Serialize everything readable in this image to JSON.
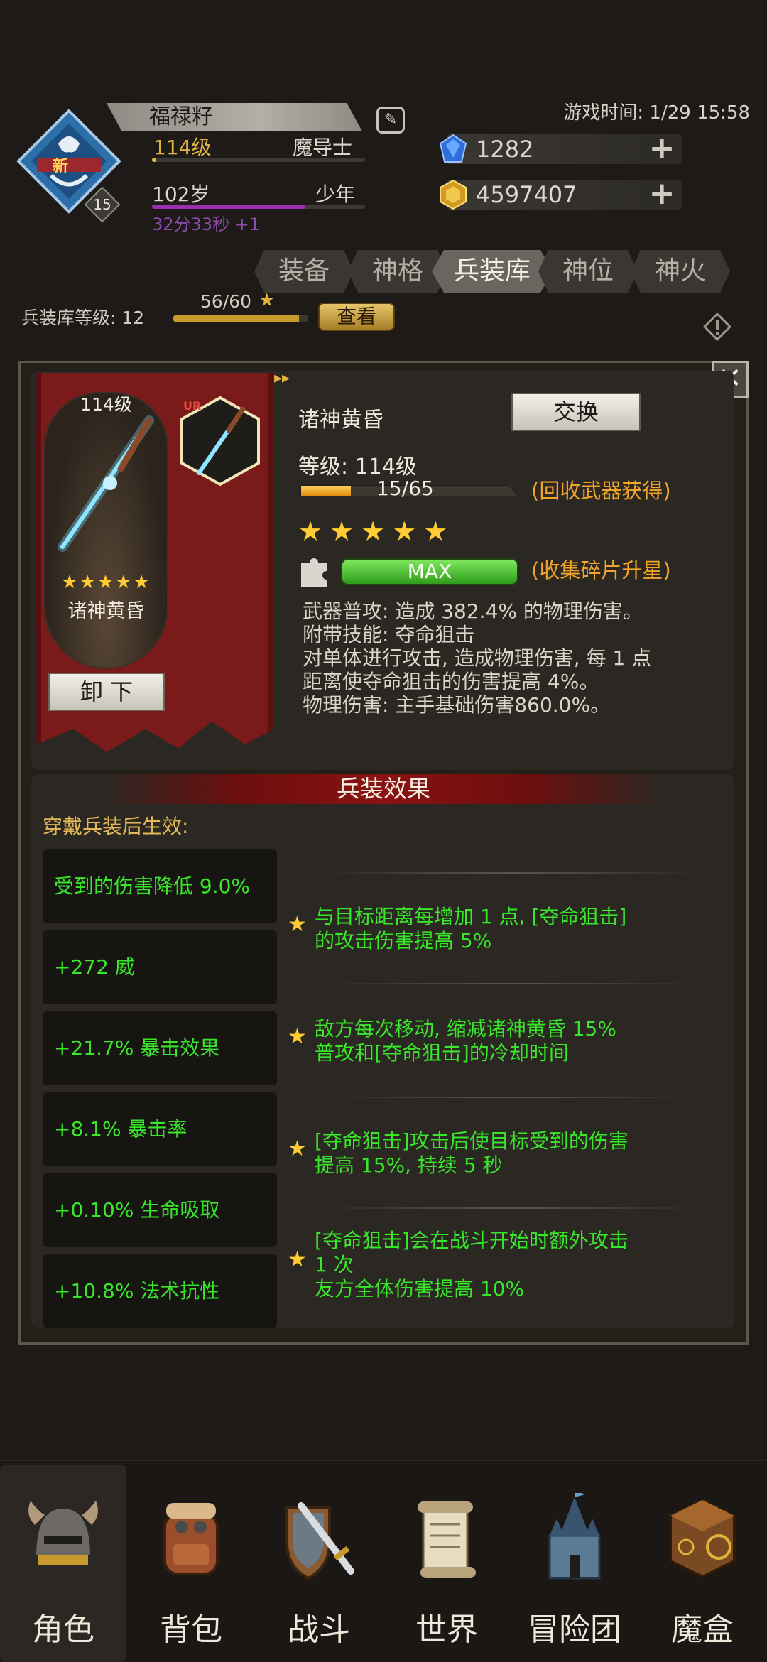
{
  "header": {
    "player_name": "福禄籽",
    "new_badge": "新",
    "emblem_level": "15",
    "level": "114级",
    "job": "魔导士",
    "age": "102岁",
    "age_stage": "少年",
    "timer": "32分33秒 +1",
    "game_time": "游戏时间: 1/29 15:58",
    "crystals": "1282",
    "gold": "4597407"
  },
  "tabs": [
    "装备",
    "神格",
    "兵装库",
    "神位",
    "神火"
  ],
  "active_tab": "兵装库",
  "armory": {
    "level_label": "兵装库等级: 12",
    "progress": "56/60",
    "progress_fraction": 0.933,
    "check_label": "查看"
  },
  "weapon": {
    "slot_level": "114级",
    "slot_stars": "★★★★★",
    "slot_name": "诸神黄昏",
    "unequip_label": "卸 下",
    "rarity": "UR",
    "name": "诸神黄昏",
    "swap_label": "交换",
    "level_label": "等级: 114级",
    "xp": "15/65",
    "xp_fraction": 0.23,
    "xp_hint": "(回收武器获得)",
    "stars": "★★★★★",
    "max_label": "MAX",
    "shard_hint": "(收集碎片升星)",
    "desc": [
      "武器普攻: 造成 382.4% 的物理伤害。",
      "附带技能: 夺命狙击",
      "对单体进行攻击, 造成物理伤害, 每 1 点",
      "距离使夺命狙击的伤害提高 4%。",
      "物理伤害: 主手基础伤害860.0%。"
    ]
  },
  "effects": {
    "title": "兵装效果",
    "caption": "穿戴兵装后生效:",
    "stats": [
      "受到的伤害降低 9.0%",
      "+272 威",
      "+21.7% 暴击效果",
      "+8.1% 暴击率",
      "+0.10% 生命吸取",
      "+10.8% 法术抗性"
    ],
    "passives": [
      "与目标距离每增加 1 点, [夺命狙击]\n的攻击伤害提高 5%",
      "敌方每次移动, 缩减诸神黄昏 15%\n普攻和[夺命狙击]的冷却时间",
      "[夺命狙击]攻击后使目标受到的伤害\n提高 15%, 持续 5 秒",
      "[夺命狙击]会在战斗开始时额外攻击\n1 次\n友方全体伤害提高 10%"
    ]
  },
  "nav": [
    {
      "label": "角色",
      "icon": "helmet-icon"
    },
    {
      "label": "背包",
      "icon": "backpack-icon"
    },
    {
      "label": "战斗",
      "icon": "sword-shield-icon"
    },
    {
      "label": "世界",
      "icon": "scroll-icon"
    },
    {
      "label": "冒险团",
      "icon": "castle-icon"
    },
    {
      "label": "魔盒",
      "icon": "magic-box-icon"
    }
  ],
  "colors": {
    "stat_green": "#38e62a",
    "star_gold": "#ffcc33",
    "hint_orange": "#f0a52a",
    "banner_red": "#7a1a1a"
  }
}
